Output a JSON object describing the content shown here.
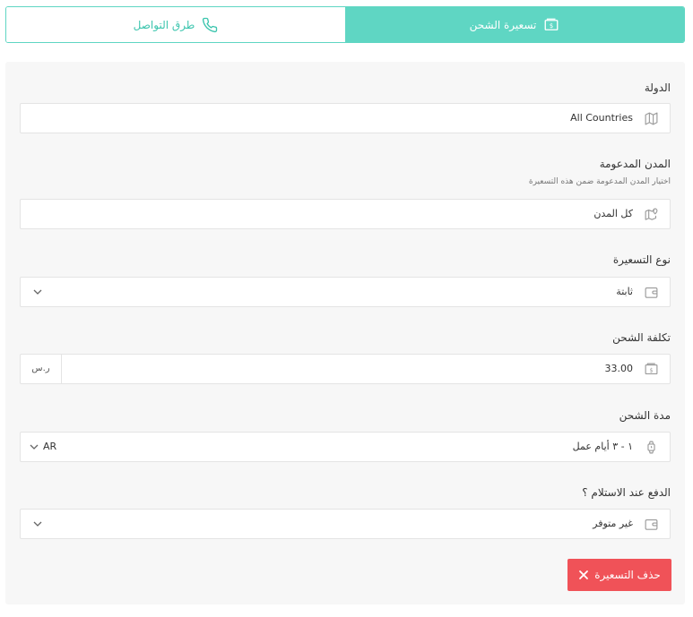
{
  "tabs": {
    "shipping_pricing": "تسعيرة الشحن",
    "contact_methods": "طرق التواصل"
  },
  "form": {
    "country": {
      "label": "الدولة",
      "value": "All Countries"
    },
    "cities": {
      "label": "المدن المدعومة",
      "hint": "اختيار المدن المدعومة ضمن هذه التسعيرة",
      "value": "كل المدن"
    },
    "pricing_type": {
      "label": "نوع التسعيرة",
      "value": "ثابتة"
    },
    "shipping_cost": {
      "label": "تكلفة الشحن",
      "value": "33.00",
      "currency": "ر.س"
    },
    "shipping_duration": {
      "label": "مدة الشحن",
      "value": "١ - ٣ أيام عمل",
      "lang": "AR"
    },
    "cod": {
      "label": "الدفع عند الاستلام ؟",
      "value": "غير متوفر"
    }
  },
  "actions": {
    "delete_pricing": "حذف التسعيرة"
  },
  "colors": {
    "accent": "#5fd6c3",
    "danger": "#f05258"
  },
  "icons": [
    "money-icon",
    "phone-icon",
    "map-icon",
    "location-icon",
    "wallet-icon",
    "watch-icon",
    "chevron-down-icon",
    "close-icon"
  ]
}
